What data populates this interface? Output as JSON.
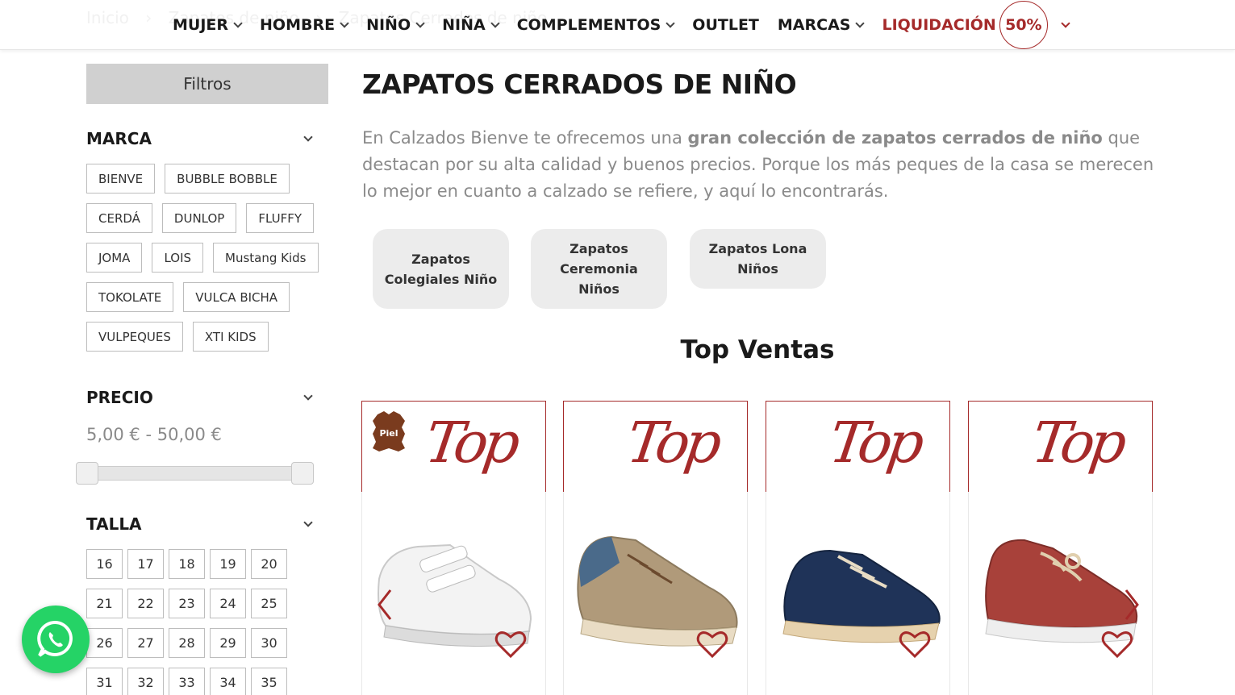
{
  "breadcrumb": [
    "Inicio",
    "›",
    "Zapatos de niño",
    "›",
    "Zapatos Cerrados de niño"
  ],
  "nav": {
    "items": [
      {
        "label": "MUJER",
        "has_dropdown": true
      },
      {
        "label": "HOMBRE",
        "has_dropdown": true
      },
      {
        "label": "NIÑO",
        "has_dropdown": true
      },
      {
        "label": "NIÑA",
        "has_dropdown": true
      },
      {
        "label": "COMPLEMENTOS",
        "has_dropdown": true
      },
      {
        "label": "OUTLET",
        "has_dropdown": false
      },
      {
        "label": "MARCAS",
        "has_dropdown": true
      }
    ],
    "sale_label": "LIQUIDACIÓN",
    "sale_badge": "50%",
    "sale_color": "#a52a2a"
  },
  "sidebar": {
    "filters_label": "Filtros",
    "brand_title": "MARCA",
    "brands": [
      "BIENVE",
      "BUBBLE BOBBLE",
      "CERDÁ",
      "DUNLOP",
      "FLUFFY",
      "JOMA",
      "LOIS",
      "Mustang Kids",
      "TOKOLATE",
      "VULCA BICHA",
      "VULPEQUES",
      "XTI KIDS"
    ],
    "price_title": "PRECIO",
    "price_range": "5,00 € - 50,00 €",
    "size_title": "TALLA",
    "sizes": [
      "16",
      "17",
      "18",
      "19",
      "20",
      "21",
      "22",
      "23",
      "24",
      "25",
      "26",
      "27",
      "28",
      "29",
      "30",
      "31",
      "32",
      "33",
      "34",
      "35"
    ]
  },
  "main": {
    "title": "ZAPATOS CERRADOS DE NIÑO",
    "intro_start": "En Calzados Bienve te ofrecemos una ",
    "intro_bold": "gran colección de zapatos cerrados de niño",
    "intro_end": " que destacan por su alta calidad y buenos precios. Porque los más peques de la casa se merecen lo mejor en cuanto a calzado se refiere, y aquí lo encontrarás.",
    "subcategories": [
      "Zapatos Colegiales Niño",
      "Zapatos Ceremonia Niños",
      "Zapatos Lona Niños"
    ],
    "top_title": "Top Ventas",
    "top_badge_text": "Top",
    "piel_badge": "Piel",
    "products": [
      {
        "color": "white-velcro-sneaker-icon"
      },
      {
        "color": "beige-lace-sneaker-icon"
      },
      {
        "color": "navy-canvas-shoe-icon"
      },
      {
        "color": "red-boat-shoe-icon"
      }
    ]
  },
  "accent_color": "#a52a2a",
  "whatsapp_color": "#25d366"
}
